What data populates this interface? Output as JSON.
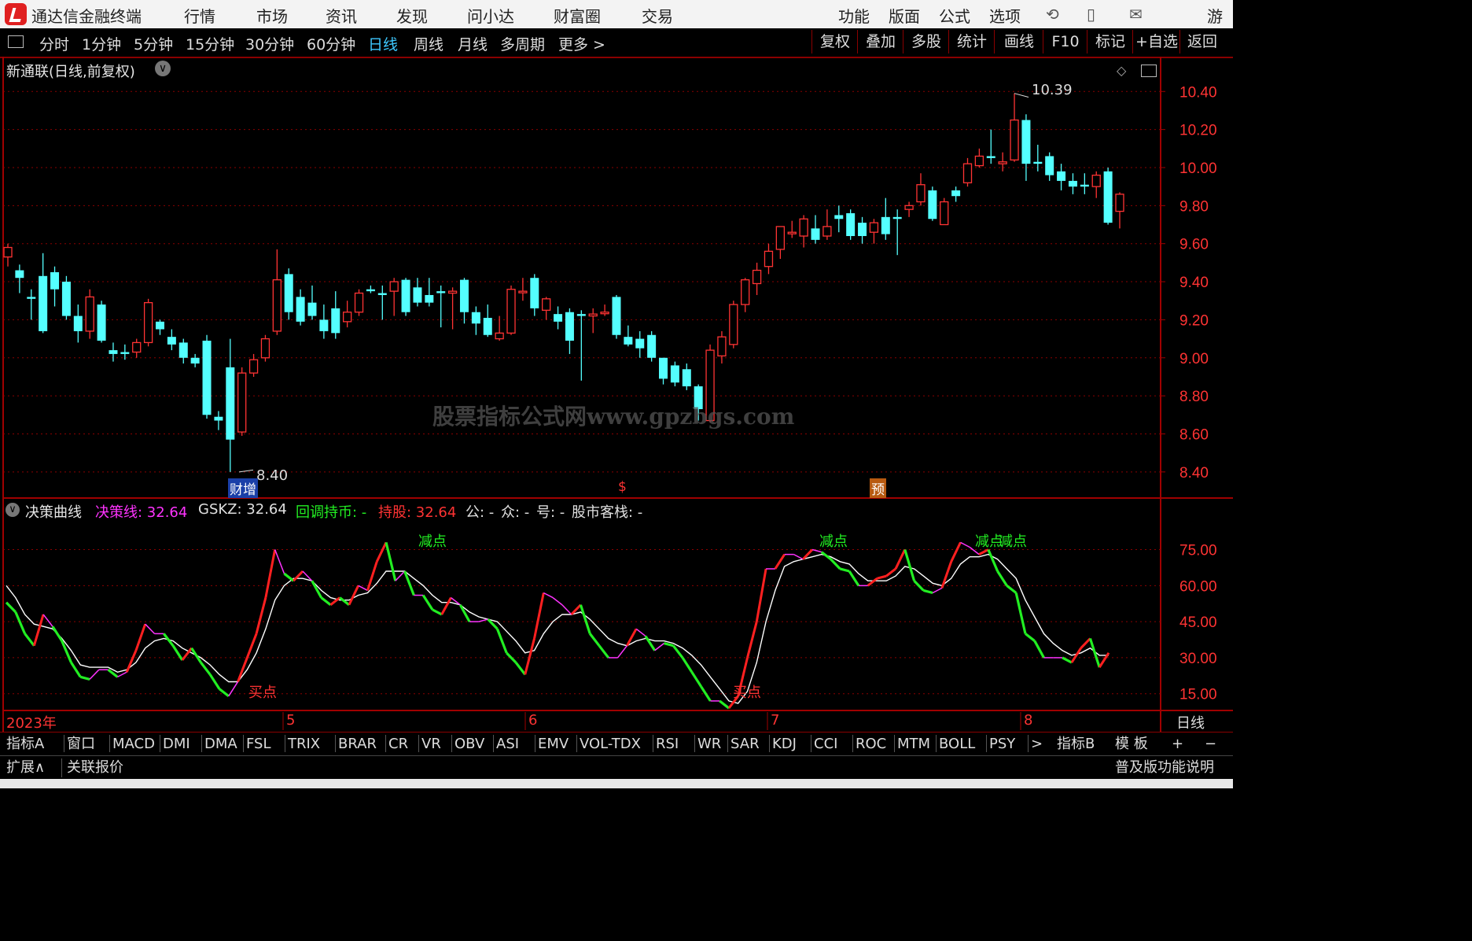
{
  "topbar": {
    "app_name": "通达信金融终端",
    "menus": [
      "行情",
      "市场",
      "资讯",
      "发现",
      "问小达",
      "财富圈",
      "交易"
    ],
    "right_menus": [
      "功能",
      "版面",
      "公式",
      "选项"
    ],
    "user": "游客"
  },
  "periods": [
    "分时",
    "1分钟",
    "5分钟",
    "15分钟",
    "30分钟",
    "60分钟",
    "日线",
    "周线",
    "月线",
    "多周期",
    "更多 >"
  ],
  "active_period": "日线",
  "tools": [
    "复权",
    "叠加",
    "多股",
    "统计",
    "画线",
    "F10",
    "标记",
    "+自选",
    "返回"
  ],
  "main_panel": {
    "title": "新通联(日线,前复权)",
    "price_axis": [
      "10.40",
      "10.20",
      "10.00",
      "9.80",
      "9.60",
      "9.40",
      "9.20",
      "9.00",
      "8.80",
      "8.60",
      "8.40"
    ],
    "high_label": "10.39",
    "low_label": "8.40",
    "watermark": "股票指标公式网www.gpzbgs.com",
    "markers": [
      "财增",
      "$",
      "预"
    ]
  },
  "indicator_panel": {
    "name": "决策曲线",
    "items": [
      {
        "label": "决策线: 32.64",
        "color": "#ff33ff"
      },
      {
        "label": "GSKZ: 32.64",
        "color": "#e0e0e0"
      },
      {
        "label": "回调持币: -",
        "color": "#22ee22"
      },
      {
        "label": "持股: 32.64",
        "color": "#ff3333"
      },
      {
        "label": "公: -",
        "color": "#e0e0e0"
      },
      {
        "label": "众: -",
        "color": "#e0e0e0"
      },
      {
        "label": "号: -",
        "color": "#e0e0e0"
      },
      {
        "label": "股市客栈: -",
        "color": "#e0e0e0"
      }
    ],
    "axis": [
      "75.00",
      "60.00",
      "45.00",
      "30.00",
      "15.00"
    ],
    "annotations": {
      "buy": "买点",
      "sell": "减点"
    }
  },
  "date_axis": {
    "labels": [
      "2023年",
      "5",
      "6",
      "7",
      "8"
    ],
    "period": "日线"
  },
  "indicator_tabs": [
    "指标A",
    "窗口",
    "MACD",
    "DMI",
    "DMA",
    "FSL",
    "TRIX",
    "BRAR",
    "CR",
    "VR",
    "OBV",
    "ASI",
    "EMV",
    "VOL-TDX",
    "RSI",
    "WR",
    "SAR",
    "KDJ",
    "CCI",
    "ROC",
    "MTM",
    "BOLL",
    "PSY",
    ">"
  ],
  "right_tabs": [
    "指标B",
    "模 板",
    "+",
    "−"
  ],
  "bottom": {
    "expand": "扩展∧",
    "linked": "关联报价",
    "help": "普及版功能说明"
  },
  "chart_data": {
    "type": "candlestick",
    "y_range": [
      8.3,
      10.55
    ],
    "candles": [
      [
        9.53,
        9.58,
        9.6,
        9.48
      ],
      [
        9.46,
        9.42,
        9.49,
        9.34
      ],
      [
        9.32,
        9.31,
        9.36,
        9.2
      ],
      [
        9.43,
        9.14,
        9.55,
        9.13
      ],
      [
        9.45,
        9.36,
        9.48,
        9.27
      ],
      [
        9.4,
        9.22,
        9.43,
        9.2
      ],
      [
        9.22,
        9.14,
        9.28,
        9.08
      ],
      [
        9.14,
        9.32,
        9.36,
        9.1
      ],
      [
        9.28,
        9.09,
        9.3,
        9.08
      ],
      [
        9.04,
        9.02,
        9.08,
        8.98
      ],
      [
        9.03,
        9.02,
        9.07,
        8.99
      ],
      [
        9.03,
        9.08,
        9.1,
        9.0
      ],
      [
        9.08,
        9.29,
        9.31,
        9.06
      ],
      [
        9.19,
        9.15,
        9.2,
        9.12
      ],
      [
        9.11,
        9.07,
        9.15,
        9.04
      ],
      [
        9.08,
        9.0,
        9.1,
        8.97
      ],
      [
        9.0,
        8.97,
        9.02,
        8.95
      ],
      [
        9.09,
        8.7,
        9.12,
        8.68
      ],
      [
        8.69,
        8.67,
        8.72,
        8.62
      ],
      [
        8.95,
        8.57,
        9.1,
        8.4
      ],
      [
        8.61,
        8.92,
        8.95,
        8.59
      ],
      [
        8.92,
        8.99,
        9.02,
        8.9
      ],
      [
        9.0,
        9.1,
        9.12,
        8.98
      ],
      [
        9.14,
        9.41,
        9.57,
        9.12
      ],
      [
        9.44,
        9.24,
        9.47,
        9.2
      ],
      [
        9.32,
        9.19,
        9.36,
        9.17
      ],
      [
        9.29,
        9.22,
        9.38,
        9.2
      ],
      [
        9.2,
        9.14,
        9.28,
        9.1
      ],
      [
        9.26,
        9.13,
        9.35,
        9.1
      ],
      [
        9.19,
        9.24,
        9.3,
        9.16
      ],
      [
        9.24,
        9.34,
        9.36,
        9.22
      ],
      [
        9.36,
        9.35,
        9.38,
        9.34
      ],
      [
        9.34,
        9.33,
        9.38,
        9.2
      ],
      [
        9.35,
        9.4,
        9.42,
        9.22
      ],
      [
        9.41,
        9.24,
        9.42,
        9.22
      ],
      [
        9.37,
        9.29,
        9.42,
        9.27
      ],
      [
        9.33,
        9.29,
        9.42,
        9.27
      ],
      [
        9.35,
        9.34,
        9.38,
        9.16
      ],
      [
        9.34,
        9.35,
        9.37,
        9.15
      ],
      [
        9.41,
        9.24,
        9.42,
        9.18
      ],
      [
        9.24,
        9.18,
        9.27,
        9.12
      ],
      [
        9.21,
        9.12,
        9.28,
        9.11
      ],
      [
        9.1,
        9.13,
        9.22,
        9.09
      ],
      [
        9.13,
        9.36,
        9.38,
        9.12
      ],
      [
        9.35,
        9.35,
        9.42,
        9.3
      ],
      [
        9.42,
        9.26,
        9.44,
        9.22
      ],
      [
        9.25,
        9.31,
        9.32,
        9.2
      ],
      [
        9.23,
        9.19,
        9.27,
        9.15
      ],
      [
        9.24,
        9.09,
        9.26,
        9.02
      ],
      [
        9.23,
        9.22,
        9.25,
        8.88
      ],
      [
        9.22,
        9.23,
        9.26,
        9.13
      ],
      [
        9.24,
        9.24,
        9.28,
        9.22
      ],
      [
        9.32,
        9.12,
        9.33,
        9.1
      ],
      [
        9.11,
        9.07,
        9.17,
        9.06
      ],
      [
        9.1,
        9.05,
        9.14,
        9.0
      ],
      [
        9.12,
        9.0,
        9.14,
        8.98
      ],
      [
        9.0,
        8.89,
        9.0,
        8.86
      ],
      [
        8.96,
        8.87,
        8.98,
        8.85
      ],
      [
        8.94,
        8.85,
        8.97,
        8.83
      ],
      [
        8.85,
        8.73,
        8.86,
        8.67
      ],
      [
        8.67,
        9.04,
        9.07,
        8.66
      ],
      [
        9.01,
        9.11,
        9.14,
        8.97
      ],
      [
        9.07,
        9.28,
        9.3,
        9.05
      ],
      [
        9.28,
        9.41,
        9.42,
        9.24
      ],
      [
        9.39,
        9.46,
        9.5,
        9.33
      ],
      [
        9.48,
        9.56,
        9.6,
        9.44
      ],
      [
        9.57,
        9.69,
        9.69,
        9.52
      ],
      [
        9.66,
        9.66,
        9.72,
        9.63
      ],
      [
        9.64,
        9.73,
        9.75,
        9.58
      ],
      [
        9.68,
        9.62,
        9.75,
        9.6
      ],
      [
        9.64,
        9.69,
        9.78,
        9.62
      ],
      [
        9.75,
        9.73,
        9.8,
        9.66
      ],
      [
        9.76,
        9.64,
        9.78,
        9.62
      ],
      [
        9.71,
        9.64,
        9.74,
        9.6
      ],
      [
        9.66,
        9.71,
        9.73,
        9.6
      ],
      [
        9.74,
        9.65,
        9.84,
        9.62
      ],
      [
        9.74,
        9.73,
        9.78,
        9.54
      ],
      [
        9.78,
        9.8,
        9.82,
        9.74
      ],
      [
        9.82,
        9.91,
        9.97,
        9.8
      ],
      [
        9.88,
        9.73,
        9.9,
        9.72
      ],
      [
        9.7,
        9.82,
        9.84,
        9.7
      ],
      [
        9.88,
        9.85,
        9.9,
        9.82
      ],
      [
        9.92,
        10.02,
        10.05,
        9.9
      ],
      [
        10.01,
        10.06,
        10.1,
        10.0
      ],
      [
        10.06,
        10.05,
        10.2,
        10.02
      ],
      [
        10.02,
        10.03,
        10.08,
        9.98
      ],
      [
        10.04,
        10.25,
        10.39,
        10.03
      ],
      [
        10.25,
        10.02,
        10.28,
        9.93
      ],
      [
        10.03,
        10.02,
        10.12,
        9.98
      ],
      [
        10.06,
        9.96,
        10.08,
        9.93
      ],
      [
        9.98,
        9.93,
        10.02,
        9.88
      ],
      [
        9.93,
        9.9,
        9.97,
        9.86
      ],
      [
        9.91,
        9.9,
        9.97,
        9.86
      ],
      [
        9.9,
        9.96,
        9.98,
        9.84
      ],
      [
        9.98,
        9.71,
        10.0,
        9.7
      ],
      [
        9.77,
        9.86,
        9.87,
        9.68
      ]
    ],
    "indicator": {
      "y_range": [
        10,
        85
      ],
      "decision_line": [
        53,
        49,
        40,
        35,
        48,
        43,
        37,
        28,
        22,
        21,
        25,
        25,
        22,
        24,
        33,
        44,
        40,
        40,
        35,
        29,
        34,
        28,
        23,
        17,
        14,
        20,
        30,
        40,
        55,
        75,
        65,
        62,
        66,
        62,
        55,
        52,
        55,
        52,
        60,
        58,
        70,
        78,
        62,
        66,
        56,
        56,
        50,
        48,
        55,
        52,
        45,
        45,
        46,
        42,
        32,
        28,
        23,
        38,
        57,
        55,
        52,
        48,
        52,
        40,
        35,
        30,
        30,
        35,
        42,
        39,
        33,
        36,
        35,
        30,
        24,
        18,
        12,
        12,
        9,
        14,
        30,
        45,
        67,
        67,
        73,
        73,
        71,
        75,
        74,
        71,
        67,
        66,
        60,
        60,
        63,
        64,
        67,
        75,
        62,
        58,
        57,
        59,
        70,
        78,
        76,
        73,
        75,
        66,
        60,
        57,
        40,
        37,
        30,
        30,
        30,
        28,
        34,
        38,
        26,
        32
      ],
      "gskz": [
        60,
        55,
        48,
        44,
        43,
        42,
        38,
        33,
        27,
        26,
        26,
        26,
        24,
        25,
        28,
        34,
        37,
        38,
        37,
        34,
        32,
        30,
        27,
        23,
        20,
        20,
        25,
        32,
        42,
        54,
        60,
        63,
        63,
        62,
        58,
        55,
        54,
        54,
        56,
        57,
        61,
        66,
        66,
        66,
        63,
        60,
        56,
        53,
        53,
        52,
        49,
        47,
        46,
        45,
        41,
        37,
        32,
        33,
        40,
        45,
        48,
        48,
        49,
        46,
        42,
        38,
        36,
        35,
        37,
        38,
        37,
        37,
        36,
        34,
        31,
        27,
        22,
        17,
        12,
        11,
        16,
        28,
        45,
        58,
        68,
        70,
        71,
        72,
        73,
        72,
        70,
        69,
        65,
        62,
        62,
        62,
        64,
        68,
        67,
        64,
        61,
        60,
        63,
        69,
        72,
        72,
        73,
        71,
        67,
        63,
        54,
        47,
        40,
        36,
        33,
        31,
        32,
        34,
        31,
        31
      ]
    }
  }
}
